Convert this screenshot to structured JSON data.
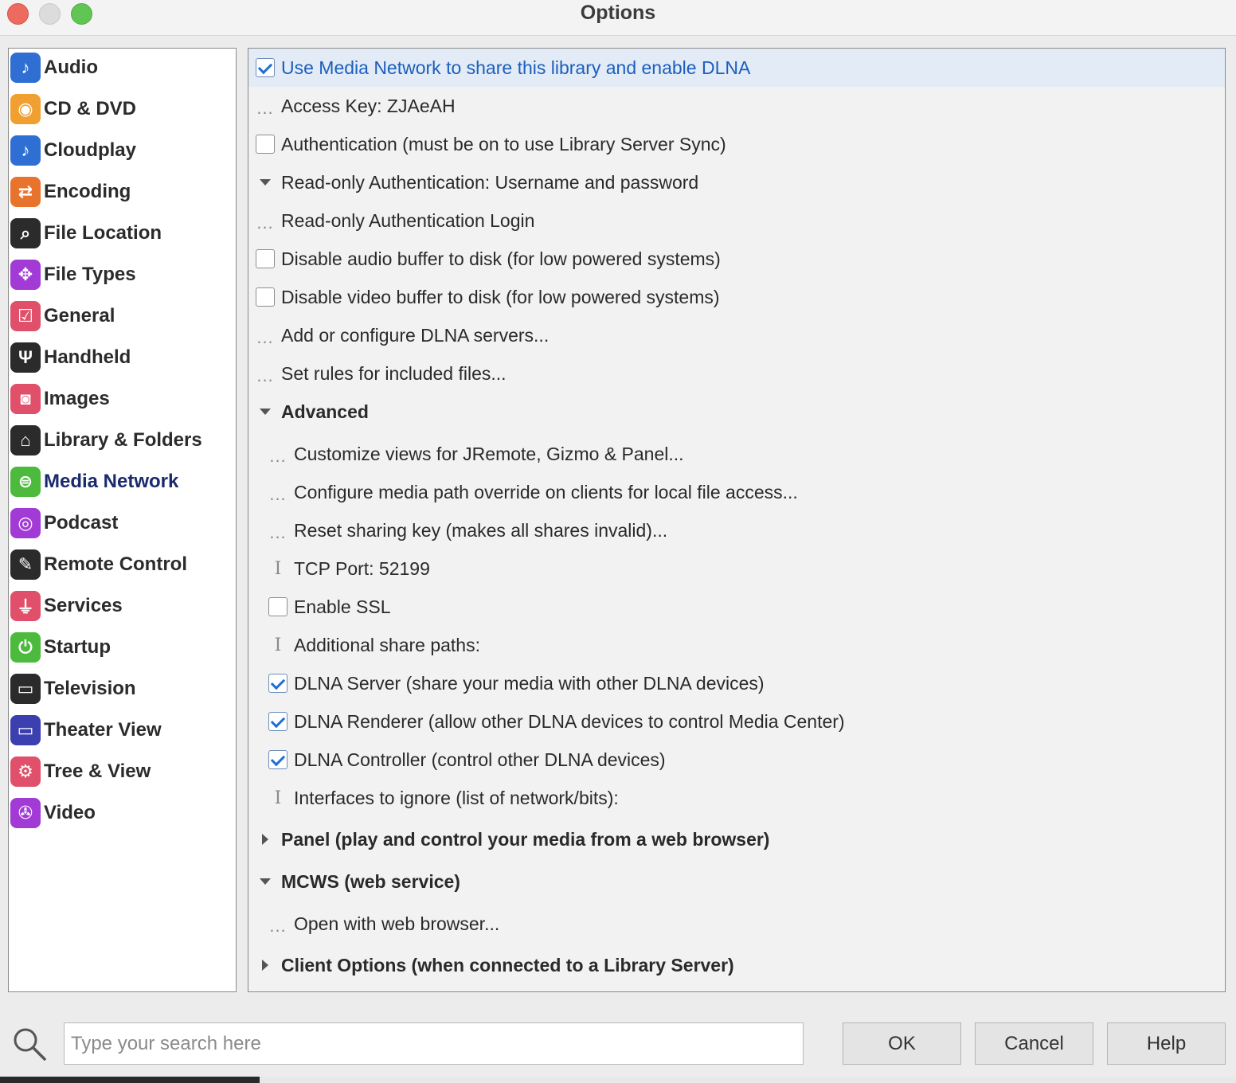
{
  "window": {
    "title": "Options"
  },
  "sidebar": {
    "items": [
      {
        "label": "Audio",
        "icon": "music-note-icon",
        "color": "#2f6fd4",
        "glyph": "♪"
      },
      {
        "label": "CD & DVD",
        "icon": "disc-icon",
        "color": "#f0a030",
        "glyph": "◉"
      },
      {
        "label": "Cloudplay",
        "icon": "music-note-icon",
        "color": "#2f6fd4",
        "glyph": "♪"
      },
      {
        "label": "Encoding",
        "icon": "arrows-swap-icon",
        "color": "#e8732c",
        "glyph": "⇄"
      },
      {
        "label": "File Location",
        "icon": "file-search-icon",
        "color": "#2b2b2b",
        "glyph": "⌕"
      },
      {
        "label": "File Types",
        "icon": "puzzle-icon",
        "color": "#a23ad6",
        "glyph": "✥"
      },
      {
        "label": "General",
        "icon": "checkbox-icon",
        "color": "#e0506a",
        "glyph": "☑"
      },
      {
        "label": "Handheld",
        "icon": "usb-icon",
        "color": "#2b2b2b",
        "glyph": "Ψ"
      },
      {
        "label": "Images",
        "icon": "camera-icon",
        "color": "#e0506a",
        "glyph": "◙"
      },
      {
        "label": "Library & Folders",
        "icon": "house-music-icon",
        "color": "#2b2b2b",
        "glyph": "⌂"
      },
      {
        "label": "Media Network",
        "icon": "network-icon",
        "color": "#4cba3c",
        "glyph": "⊜",
        "active": true
      },
      {
        "label": "Podcast",
        "icon": "podcast-icon",
        "color": "#a23ad6",
        "glyph": "◎"
      },
      {
        "label": "Remote Control",
        "icon": "remote-icon",
        "color": "#2b2b2b",
        "glyph": "✎"
      },
      {
        "label": "Services",
        "icon": "plug-icon",
        "color": "#e0506a",
        "glyph": "⏚"
      },
      {
        "label": "Startup",
        "icon": "power-icon",
        "color": "#4cba3c",
        "glyph": "⏻"
      },
      {
        "label": "Television",
        "icon": "tv-icon",
        "color": "#2b2b2b",
        "glyph": "▭"
      },
      {
        "label": "Theater View",
        "icon": "monitor-icon",
        "color": "#3b3fb0",
        "glyph": "▭"
      },
      {
        "label": "Tree & View",
        "icon": "gear-icon",
        "color": "#e0506a",
        "glyph": "⚙"
      },
      {
        "label": "Video",
        "icon": "video-camera-icon",
        "color": "#a23ad6",
        "glyph": "✇"
      }
    ]
  },
  "options": {
    "rows": [
      {
        "type": "checkbox",
        "checked": true,
        "label": "Use Media Network to share this library and enable DLNA",
        "selected": true
      },
      {
        "type": "action",
        "label": "Access Key: ZJAeAH"
      },
      {
        "type": "checkbox",
        "checked": false,
        "label": "Authentication (must be on to use Library Server Sync)"
      },
      {
        "type": "expand-open",
        "label": "Read-only Authentication: Username and password"
      },
      {
        "type": "action",
        "label": "Read-only Authentication Login"
      },
      {
        "type": "checkbox",
        "checked": false,
        "label": "Disable audio buffer to disk (for low powered systems)"
      },
      {
        "type": "checkbox",
        "checked": false,
        "label": "Disable video buffer to disk (for low powered systems)"
      },
      {
        "type": "action",
        "label": "Add or configure DLNA servers..."
      },
      {
        "type": "action",
        "label": "Set rules for included files..."
      },
      {
        "type": "header-open",
        "label": "Advanced"
      },
      {
        "type": "action",
        "label": "Customize views for JRemote, Gizmo & Panel...",
        "indent": 2
      },
      {
        "type": "action",
        "label": "Configure media path override on clients for local file access...",
        "indent": 2
      },
      {
        "type": "action",
        "label": "Reset sharing key (makes all shares invalid)...",
        "indent": 2
      },
      {
        "type": "text",
        "label": "TCP Port: 52199",
        "indent": 2
      },
      {
        "type": "checkbox",
        "checked": false,
        "label": "Enable SSL",
        "indent": 2
      },
      {
        "type": "text",
        "label": "Additional share paths:",
        "indent": 2
      },
      {
        "type": "checkbox",
        "checked": true,
        "label": "DLNA Server (share your media with other DLNA devices)",
        "indent": 2
      },
      {
        "type": "checkbox",
        "checked": true,
        "label": "DLNA Renderer (allow other DLNA devices to control Media Center)",
        "indent": 2
      },
      {
        "type": "checkbox",
        "checked": true,
        "label": "DLNA Controller (control other DLNA devices)",
        "indent": 2
      },
      {
        "type": "text",
        "label": "Interfaces to ignore (list of network/bits):",
        "indent": 2
      },
      {
        "type": "header-closed",
        "label": "Panel (play and control your media from a web browser)"
      },
      {
        "type": "header-open",
        "label": "MCWS (web service)"
      },
      {
        "type": "action",
        "label": "Open with web browser...",
        "indent": 2
      },
      {
        "type": "header-closed",
        "label": "Client Options (when connected to a Library Server)"
      }
    ]
  },
  "footer": {
    "search_placeholder": "Type your search here",
    "ok_label": "OK",
    "cancel_label": "Cancel",
    "help_label": "Help"
  }
}
